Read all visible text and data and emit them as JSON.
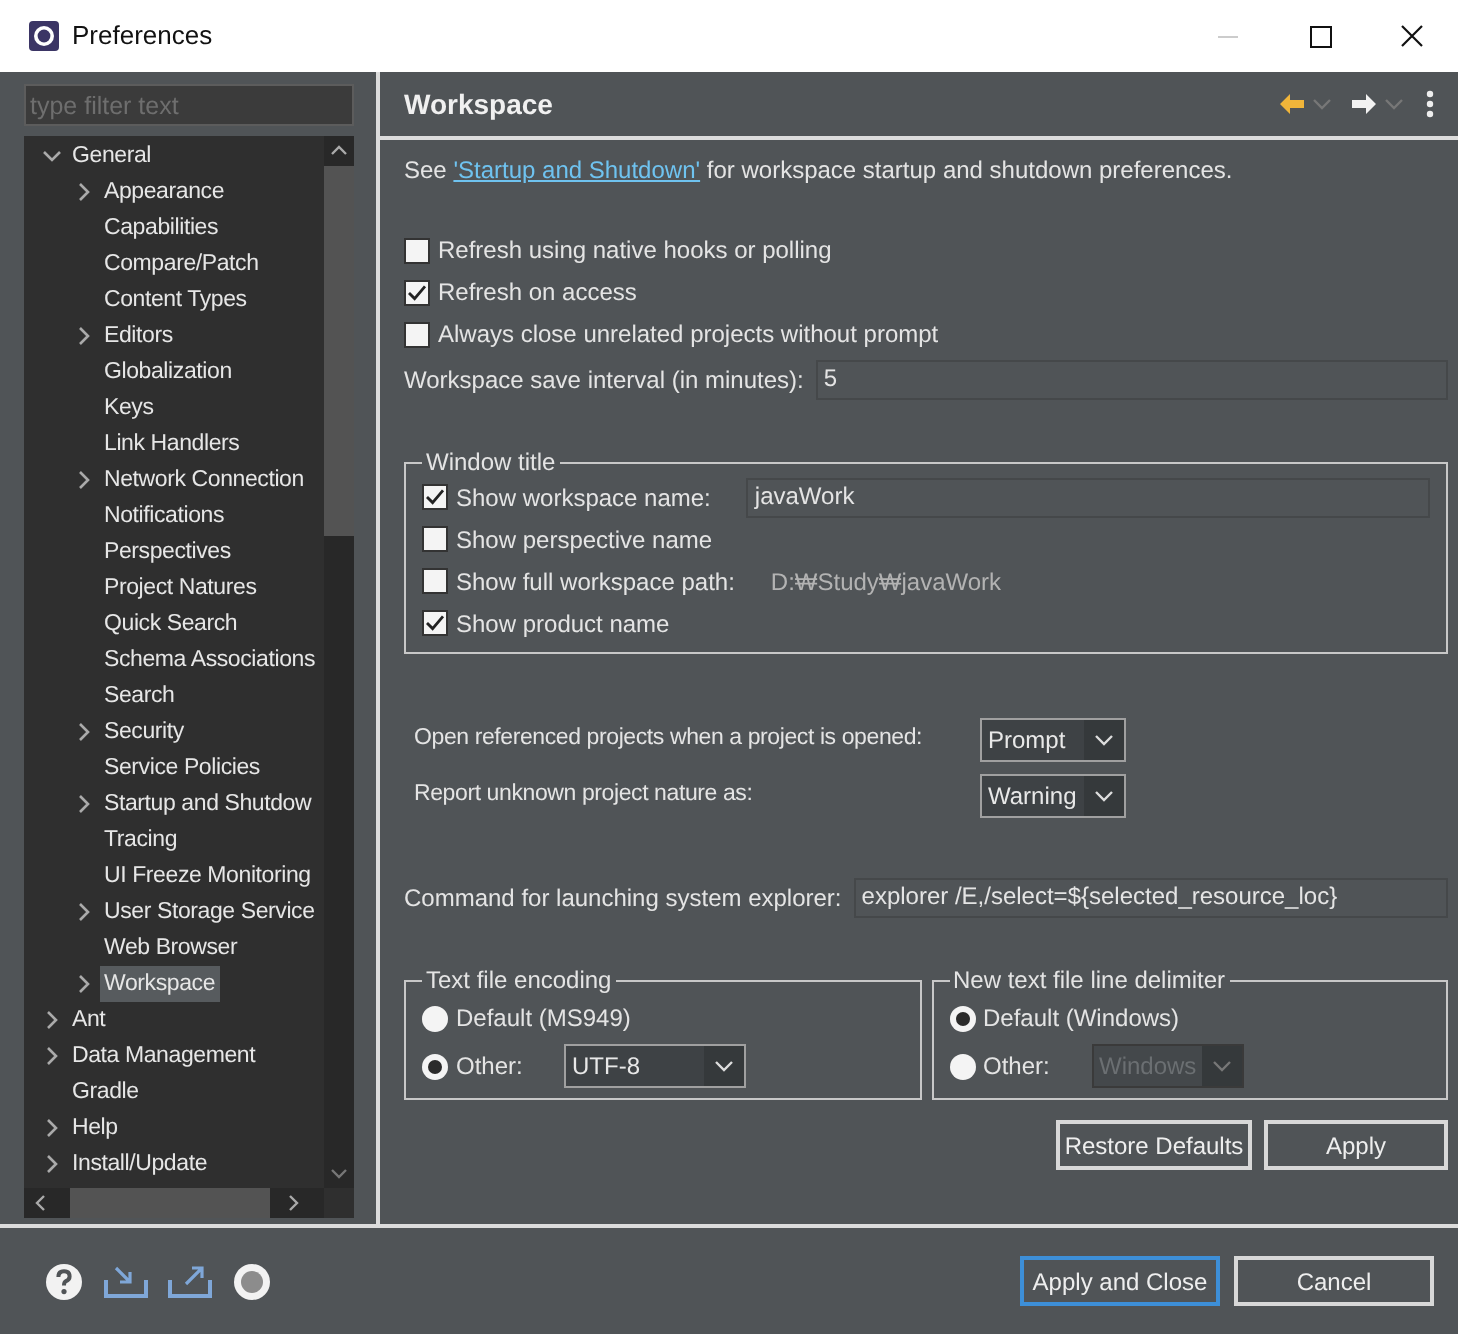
{
  "window": {
    "title": "Preferences",
    "controls": {
      "minimize_disabled": true
    }
  },
  "sidebar": {
    "filter": {
      "placeholder": "type filter text"
    },
    "items": [
      {
        "label": "General",
        "kind": "folder",
        "expanded": true,
        "selected": false,
        "children": [
          {
            "label": "Appearance",
            "kind": "folder",
            "expanded": false,
            "selected": false
          },
          {
            "label": "Capabilities",
            "kind": "leaf",
            "selected": false
          },
          {
            "label": "Compare/Patch",
            "kind": "leaf",
            "selected": false
          },
          {
            "label": "Content Types",
            "kind": "leaf",
            "selected": false
          },
          {
            "label": "Editors",
            "kind": "folder",
            "expanded": false,
            "selected": false
          },
          {
            "label": "Globalization",
            "kind": "leaf",
            "selected": false
          },
          {
            "label": "Keys",
            "kind": "leaf",
            "selected": false
          },
          {
            "label": "Link Handlers",
            "kind": "leaf",
            "selected": false
          },
          {
            "label": "Network Connection",
            "kind": "folder",
            "expanded": false,
            "selected": false
          },
          {
            "label": "Notifications",
            "kind": "leaf",
            "selected": false
          },
          {
            "label": "Perspectives",
            "kind": "leaf",
            "selected": false
          },
          {
            "label": "Project Natures",
            "kind": "leaf",
            "selected": false
          },
          {
            "label": "Quick Search",
            "kind": "leaf",
            "selected": false
          },
          {
            "label": "Schema Associations",
            "kind": "leaf",
            "selected": false
          },
          {
            "label": "Search",
            "kind": "leaf",
            "selected": false
          },
          {
            "label": "Security",
            "kind": "folder",
            "expanded": false,
            "selected": false
          },
          {
            "label": "Service Policies",
            "kind": "leaf",
            "selected": false
          },
          {
            "label": "Startup and Shutdow",
            "kind": "folder",
            "expanded": false,
            "selected": false
          },
          {
            "label": "Tracing",
            "kind": "leaf",
            "selected": false
          },
          {
            "label": "UI Freeze Monitoring",
            "kind": "leaf",
            "selected": false
          },
          {
            "label": "User Storage Service",
            "kind": "folder",
            "expanded": false,
            "selected": false
          },
          {
            "label": "Web Browser",
            "kind": "leaf",
            "selected": false
          },
          {
            "label": "Workspace",
            "kind": "folder",
            "expanded": false,
            "selected": true
          }
        ]
      },
      {
        "label": "Ant",
        "kind": "folder",
        "expanded": false,
        "selected": false
      },
      {
        "label": "Data Management",
        "kind": "folder",
        "expanded": false,
        "selected": false
      },
      {
        "label": "Gradle",
        "kind": "leaf",
        "selected": false
      },
      {
        "label": "Help",
        "kind": "folder",
        "expanded": false,
        "selected": false
      },
      {
        "label": "Install/Update",
        "kind": "folder",
        "expanded": false,
        "selected": false
      }
    ]
  },
  "page": {
    "title": "Workspace",
    "intro": {
      "before": "See",
      "link": "'Startup and Shutdown'",
      "after": "for workspace startup and shutdown preferences."
    },
    "options": [
      {
        "label": "Refresh using native hooks or polling",
        "checked": false
      },
      {
        "label": "Refresh on access",
        "checked": true
      },
      {
        "label": "Always close unrelated projects without prompt",
        "checked": false
      }
    ],
    "save_interval": {
      "label": "Workspace save interval (in minutes):",
      "value": "5"
    },
    "window_title": {
      "title": "Window title",
      "items": [
        {
          "label": "Show workspace name:",
          "checked": true,
          "kind": "field",
          "value": "javaWork"
        },
        {
          "label": "Show perspective name",
          "checked": false,
          "kind": "plain"
        },
        {
          "label": "Show full workspace path:",
          "checked": false,
          "kind": "path",
          "value": "D:₩Study₩javaWork"
        },
        {
          "label": "Show product name",
          "checked": true,
          "kind": "plain"
        }
      ]
    },
    "dropdowns": [
      {
        "label": "Open referenced projects when a project is opened:",
        "value": "Prompt"
      },
      {
        "label": "Report unknown project nature as:",
        "value": "Warning"
      }
    ],
    "explorer": {
      "label": "Command for launching system explorer:",
      "value": "explorer /E,/select=${selected_resource_loc}"
    },
    "groups": [
      {
        "title": "Text file encoding",
        "options": [
          {
            "label": "Default (MS949)",
            "selected": false
          },
          {
            "label": "Other:",
            "selected": true,
            "dropdown": {
              "value": "UTF-8",
              "disabled": false
            }
          }
        ]
      },
      {
        "title": "New text file line delimiter",
        "options": [
          {
            "label": "Default (Windows)",
            "selected": true
          },
          {
            "label": "Other:",
            "selected": false,
            "dropdown": {
              "value": "Windows",
              "disabled": true
            }
          }
        ]
      }
    ],
    "buttons": [
      "Restore Defaults",
      "Apply"
    ]
  },
  "footer": {
    "buttons": [
      {
        "label": "Apply and Close",
        "default": true
      },
      {
        "label": "Cancel",
        "default": false
      }
    ]
  }
}
